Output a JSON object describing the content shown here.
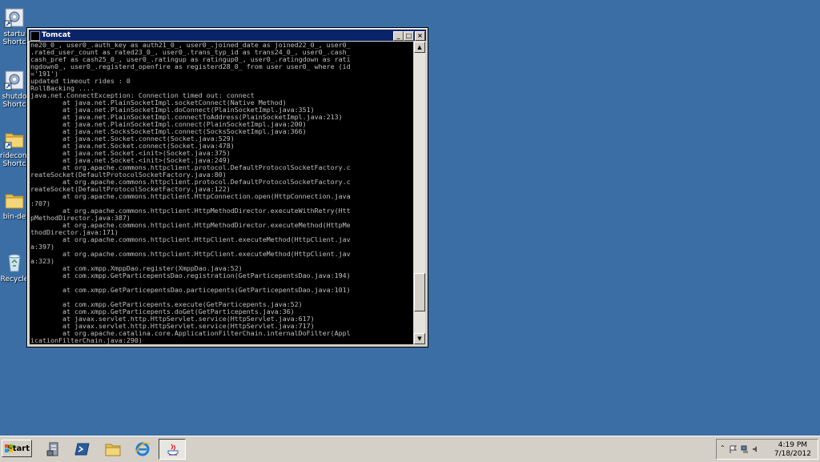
{
  "desktop": {
    "icons": [
      {
        "label": "startu",
        "sub": "Shortc",
        "icon": "gear-shortcut-icon"
      },
      {
        "label": "shutdo",
        "sub": "Shortc",
        "icon": "gear-shortcut-icon"
      },
      {
        "label": "rideconn",
        "sub": "Shortc",
        "icon": "folder-shortcut-icon"
      },
      {
        "label": "bin-de",
        "sub": "",
        "icon": "folder-icon"
      },
      {
        "label": "Recycle",
        "sub": "",
        "icon": "recycle-bin-icon"
      }
    ]
  },
  "window": {
    "title": "Tomcat",
    "minimize": "_",
    "maximize": "□",
    "close": "×",
    "lines": [
      "ne20_0_, user0_.auth_key as auth21_0_, user0_.joined_date as joined22_0_, user0_",
      ".rated_user_count as rated23_0_, user0_.trans_typ_id as trans24_0_, user0_.cash_",
      "cash_pref as cash25_0_, user0_.ratingup as ratingup0_, user0_.ratingdown as rati",
      "ngdown0_, user0_.registerd_openfire as registerd28_0_ from user user0_ where (id",
      "='191')",
      "updated timeout rides : 0",
      "RollBacking ....",
      "java.net.ConnectException: Connection timed out: connect",
      "        at java.net.PlainSocketImpl.socketConnect(Native Method)",
      "        at java.net.PlainSocketImpl.doConnect(PlainSocketImpl.java:351)",
      "        at java.net.PlainSocketImpl.connectToAddress(PlainSocketImpl.java:213)",
      "        at java.net.PlainSocketImpl.connect(PlainSocketImpl.java:200)",
      "        at java.net.SocksSocketImpl.connect(SocksSocketImpl.java:366)",
      "        at java.net.Socket.connect(Socket.java:529)",
      "        at java.net.Socket.connect(Socket.java:478)",
      "        at java.net.Socket.<init>(Socket.java:375)",
      "        at java.net.Socket.<init>(Socket.java:249)",
      "        at org.apache.commons.httpclient.protocol.DefaultProtocolSocketFactory.c",
      "reateSocket(DefaultProtocolSocketFactory.java:80)",
      "        at org.apache.commons.httpclient.protocol.DefaultProtocolSocketFactory.c",
      "reateSocket(DefaultProtocolSocketFactory.java:122)",
      "        at org.apache.commons.httpclient.HttpConnection.open(HttpConnection.java",
      ":707)",
      "        at org.apache.commons.httpclient.HttpMethodDirector.executeWithRetry(Htt",
      "pMethodDirector.java:387)",
      "        at org.apache.commons.httpclient.HttpMethodDirector.executeMethod(HttpMe",
      "thodDirector.java:171)",
      "        at org.apache.commons.httpclient.HttpClient.executeMethod(HttpClient.jav",
      "a:397)",
      "        at org.apache.commons.httpclient.HttpClient.executeMethod(HttpClient.jav",
      "a:323)",
      "        at com.xmpp.XmppDao.register(XmppDao.java:52)",
      "        at com.xmpp.GetParticepentsDao.registration(GetParticepentsDao.java:194)",
      "",
      "        at com.xmpp.GetParticepentsDao.particepents(GetParticepentsDao.java:101)",
      "",
      "        at com.xmpp.GetParticepents.execute(GetParticepents.java:52)",
      "        at com.xmpp.GetParticepents.doGet(GetParticepents.java:36)",
      "        at javax.servlet.http.HttpServlet.service(HttpServlet.java:617)",
      "        at javax.servlet.http.HttpServlet.service(HttpServlet.java:717)",
      "        at org.apache.catalina.core.ApplicationFilterChain.internalDoFilter(Appl",
      "icationFilterChain.java:290)"
    ]
  },
  "taskbar": {
    "start_label": "Start",
    "apps": [
      {
        "name": "server-manager",
        "icon": "server-manager-icon",
        "active": false
      },
      {
        "name": "powershell",
        "icon": "powershell-icon",
        "active": false
      },
      {
        "name": "explorer",
        "icon": "folder-icon",
        "active": false
      },
      {
        "name": "internet-explorer",
        "icon": "ie-icon",
        "active": false
      },
      {
        "name": "java",
        "icon": "java-icon",
        "active": true
      }
    ],
    "clock_time": "4:19 PM",
    "clock_date": "7/18/2012"
  },
  "colors": {
    "desktop": "#3a6ea5",
    "titlebar": "#0a246a",
    "console_bg": "#000000",
    "console_fg": "#c0c0c0",
    "chrome": "#d4d0c8"
  }
}
